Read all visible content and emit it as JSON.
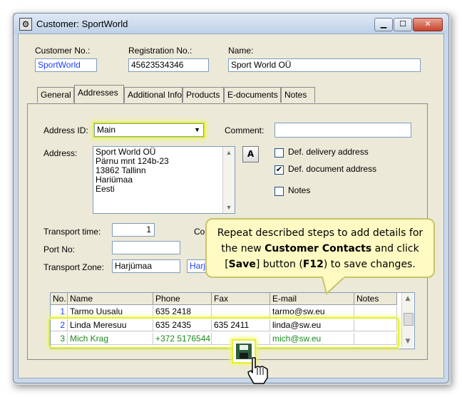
{
  "window": {
    "title": "Customer: SportWorld",
    "controls": {
      "minimize": "▁",
      "maximize": "☐",
      "close": "✕"
    }
  },
  "header": {
    "customer_no_label": "Customer No.:",
    "customer_no_value": "SportWorld",
    "registration_no_label": "Registration No.:",
    "registration_no_value": "45623534346",
    "name_label": "Name:",
    "name_value": "Sport World OÜ"
  },
  "tabs": [
    "General",
    "Addresses",
    "Additional Info",
    "Products",
    "E-documents",
    "Notes"
  ],
  "addresses": {
    "address_id_label": "Address ID:",
    "address_id_value": "Main",
    "comment_label": "Comment:",
    "comment_value": "",
    "address_label": "Address:",
    "address_lines": [
      "Sport World OÜ",
      "Pärnu mnt 124b-23",
      "13862 Tallinn",
      "Hariümaa",
      "Eesti"
    ],
    "a_button": "A",
    "def_delivery_label": "Def. delivery address",
    "def_delivery_checked": false,
    "def_document_label": "Def. document address",
    "def_document_checked": true,
    "notes_label": "Notes",
    "notes_checked": false,
    "transport_time_label": "Transport time:",
    "transport_time_value": "1",
    "co_label": "Co",
    "port_no_label": "Port No:",
    "port_no_value": "",
    "transport_zone_label": "Transport Zone:",
    "transport_zone_value": "Harjümaa",
    "zone_partial": "Harj"
  },
  "contacts": {
    "columns": [
      "No.",
      "Name",
      "Phone",
      "Fax",
      "E-mail",
      "Notes"
    ],
    "rows": [
      {
        "no": "1",
        "name": "Tarmo Uusalu",
        "phone": "635 2418",
        "fax": "",
        "email": "tarmo@sw.eu",
        "notes": ""
      },
      {
        "no": "2",
        "name": "Linda Meresuu",
        "phone": "635 2435",
        "fax": "635 2411",
        "email": "linda@sw.eu",
        "notes": ""
      },
      {
        "no": "3",
        "name": "Mich Krag",
        "phone": "+372 5176544",
        "fax": "",
        "email": "mich@sw.eu",
        "notes": ""
      }
    ]
  },
  "callout": {
    "part1": "Repeat described steps to add details for",
    "part2_pre": "the new ",
    "part2_bold": "Customer Contacts",
    "part2_post": " and click",
    "part3_open": "[",
    "part3_bold": "Save",
    "part3_mid": "] button (",
    "part3_key": "F12",
    "part3_post": ") to save changes."
  },
  "colors": {
    "highlight": "#e3ef2b",
    "link_blue": "#1f3fff",
    "green_row": "#1a8a1a",
    "callout_bg": "#fff9c2"
  },
  "icons": {
    "window_icon": "customer-icon",
    "save_icon": "floppy-disk-icon",
    "cursor_icon": "hand-cursor-icon"
  }
}
